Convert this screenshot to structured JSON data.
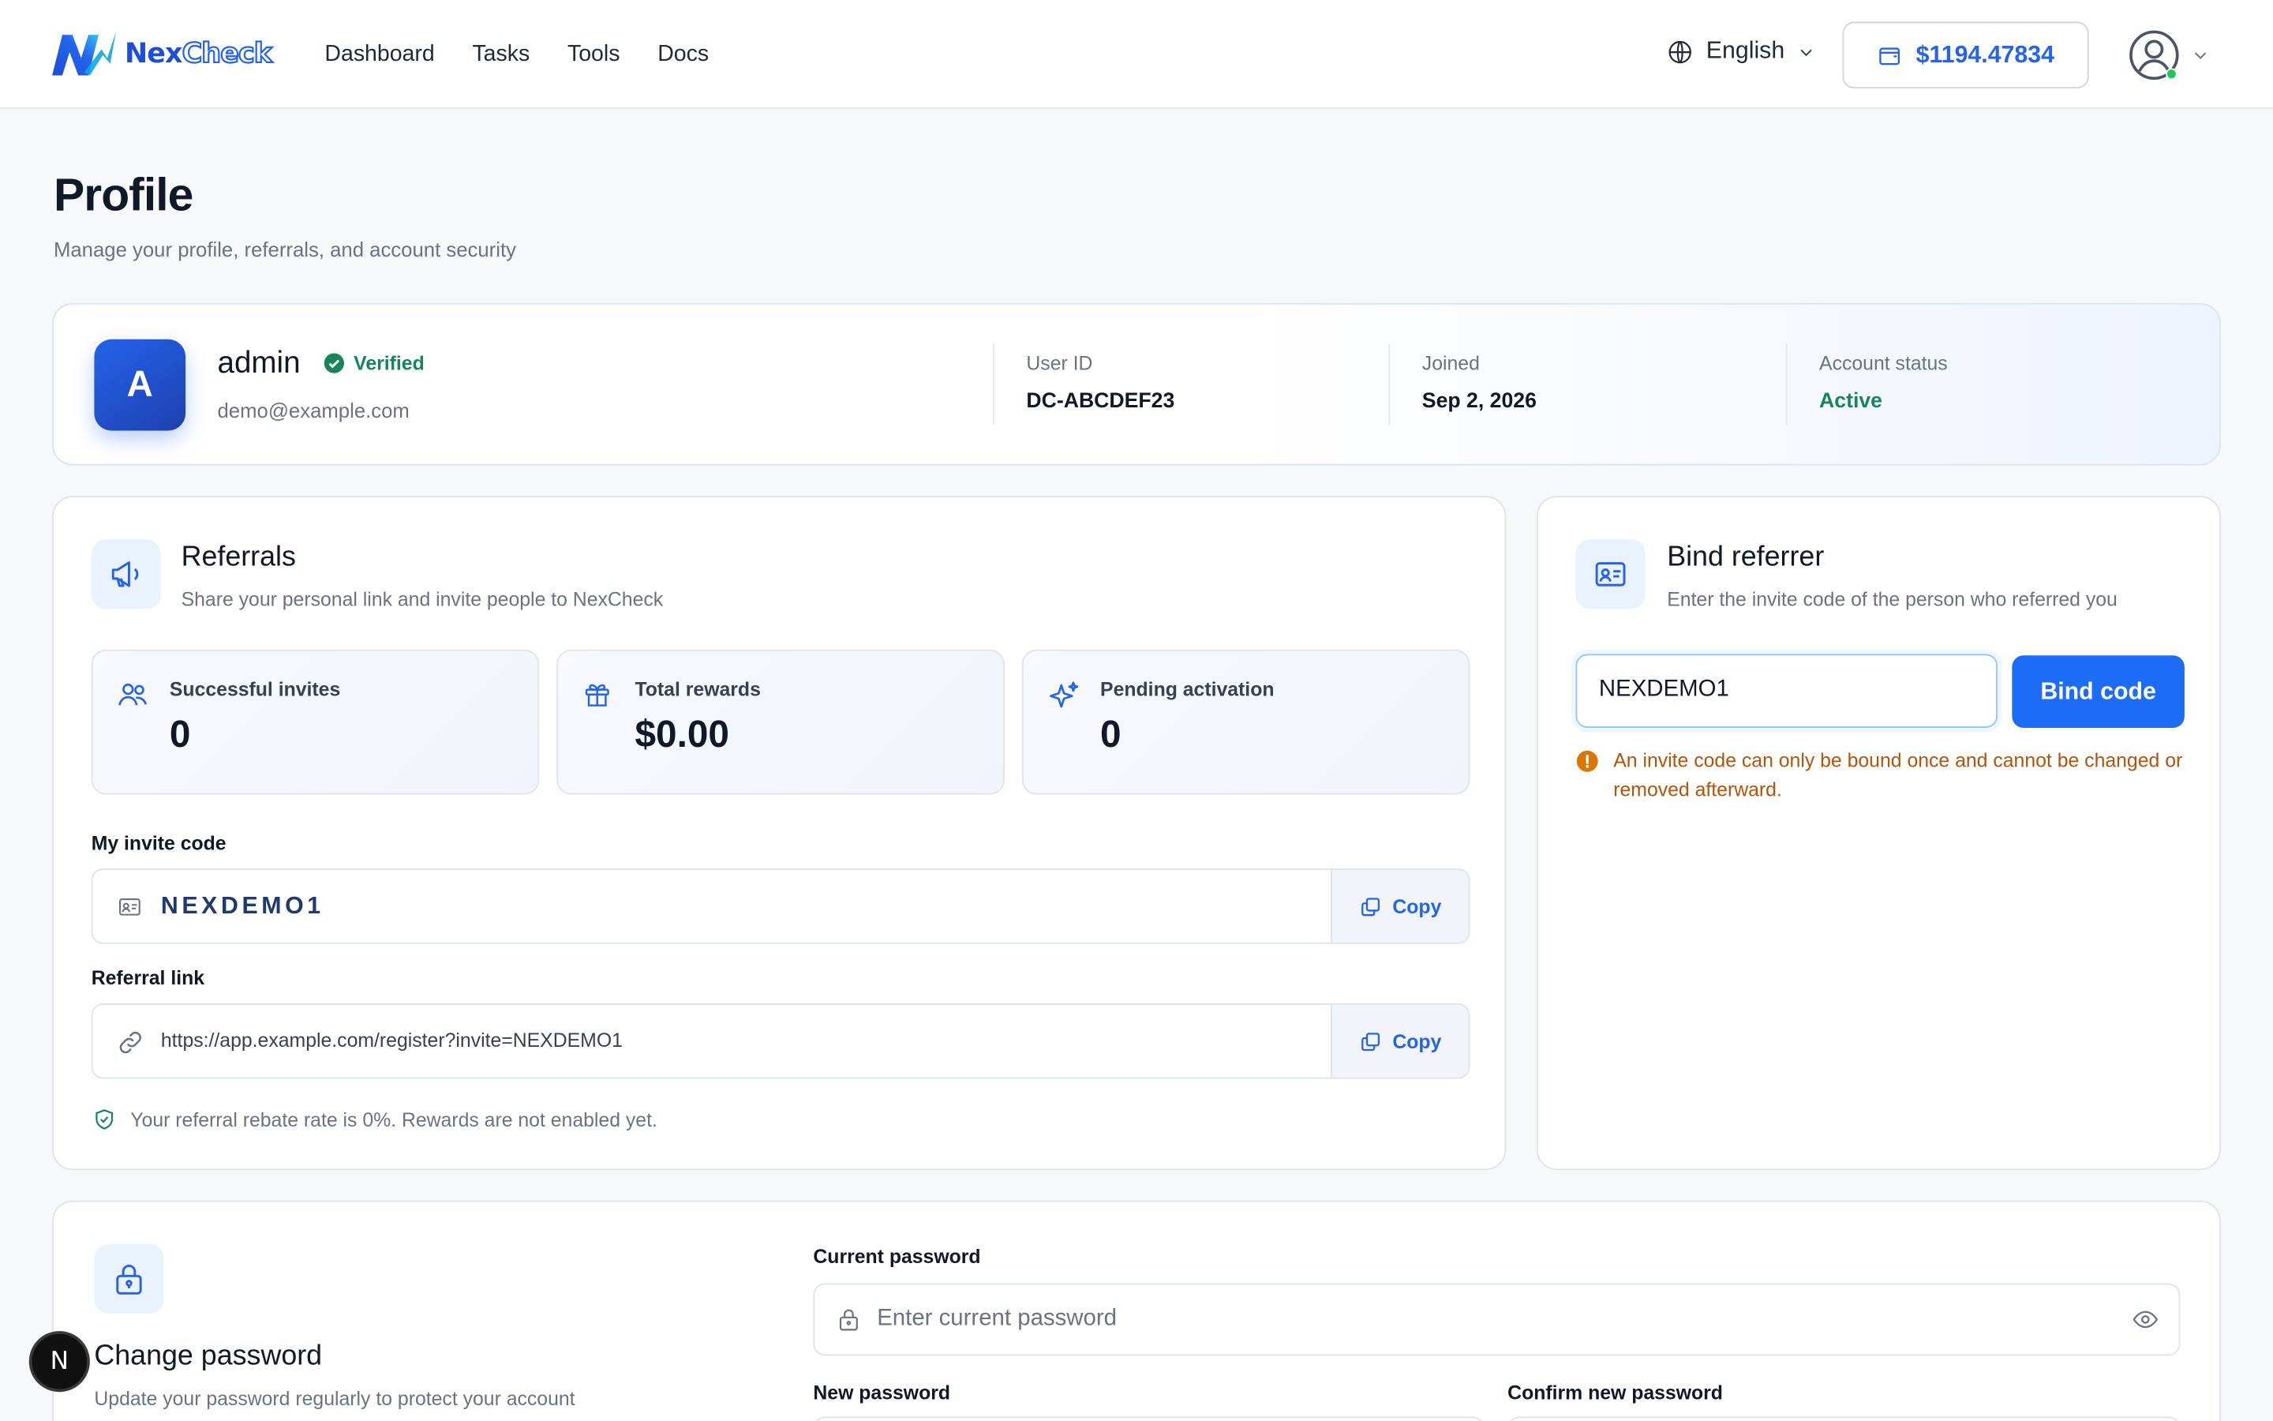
{
  "brand": {
    "part1": "Nex",
    "part2": "Check",
    "brand_color": "#2563eb"
  },
  "nav": [
    {
      "label": "Dashboard"
    },
    {
      "label": "Tasks"
    },
    {
      "label": "Tools"
    },
    {
      "label": "Docs"
    }
  ],
  "header": {
    "language": "English",
    "language_icon": "globe-icon",
    "balance": "$1194.47834",
    "balance_icon": "wallet-icon",
    "user_icon": "user-circle-icon"
  },
  "page": {
    "title": "Profile",
    "subtitle": "Manage your profile, referrals, and account security"
  },
  "profile": {
    "avatar_letter": "A",
    "username": "admin",
    "verified_label": "Verified",
    "email": "demo@example.com",
    "user_id_label": "User ID",
    "user_id": "DC-ABCDEF23",
    "joined_label": "Joined",
    "joined": "Sep 2, 2026",
    "status_label": "Account status",
    "status": "Active",
    "status_color": "#16855a"
  },
  "referrals": {
    "title": "Referrals",
    "subtitle": "Share your personal link and invite people to NexCheck",
    "stats": [
      {
        "label": "Successful invites",
        "value": "0",
        "icon": "users-icon"
      },
      {
        "label": "Total rewards",
        "value": "$0.00",
        "icon": "gift-icon"
      },
      {
        "label": "Pending activation",
        "value": "0",
        "icon": "sparkles-icon"
      }
    ],
    "invite_code_label": "My invite code",
    "invite_code": "NEXDEMO1",
    "copy_label": "Copy",
    "referral_link_label": "Referral link",
    "referral_link": "https://app.example.com/register?invite=NEXDEMO1",
    "rebate_note": "Your referral rebate rate is 0%. Rewards are not enabled yet."
  },
  "bind": {
    "title": "Bind referrer",
    "subtitle": "Enter the invite code of the person who referred you",
    "input_value": "NEXDEMO1",
    "button_label": "Bind code",
    "warning": "An invite code can only be bound once and cannot be changed or removed afterward.",
    "warning_color": "#b45309"
  },
  "password": {
    "title": "Change password",
    "subtitle": "Update your password regularly to protect your account",
    "current_label": "Current password",
    "current_placeholder": "Enter current password",
    "new_label": "New password",
    "confirm_label": "Confirm new password"
  },
  "floating_badge": "N"
}
